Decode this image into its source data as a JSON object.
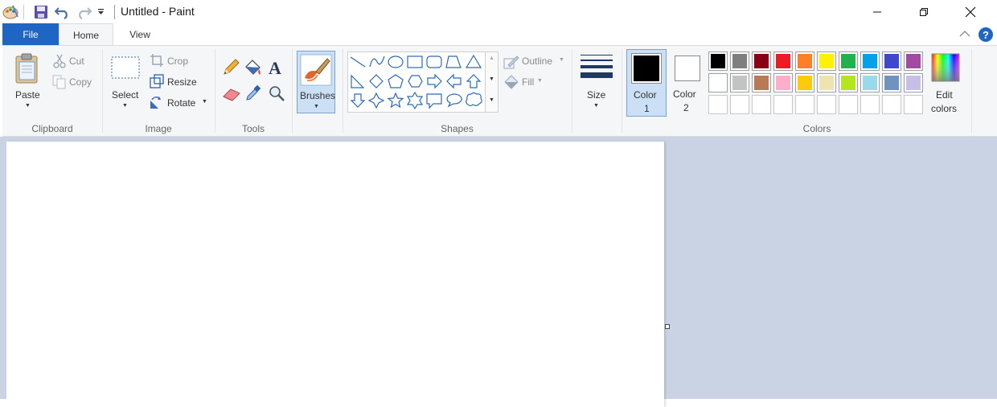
{
  "window": {
    "title": "Untitled - Paint"
  },
  "quick_access": {
    "icons": [
      "paint-app-icon",
      "save-icon",
      "undo-icon",
      "redo-icon",
      "customize-dropdown-icon"
    ]
  },
  "tabs": {
    "file": "File",
    "home": "Home",
    "view": "View"
  },
  "clipboard": {
    "paste": "Paste",
    "cut": "Cut",
    "copy": "Copy",
    "group": "Clipboard"
  },
  "image": {
    "select": "Select",
    "crop": "Crop",
    "resize": "Resize",
    "rotate": "Rotate",
    "group": "Image"
  },
  "tools": {
    "group": "Tools"
  },
  "brushes": {
    "label": "Brushes"
  },
  "shapes": {
    "outline": "Outline",
    "fill": "Fill",
    "group": "Shapes"
  },
  "size": {
    "label": "Size"
  },
  "colors": {
    "color1_line1": "Color",
    "color1_line2": "1",
    "color2_line1": "Color",
    "color2_line2": "2",
    "edit_line1": "Edit",
    "edit_line2": "colors",
    "group": "Colors",
    "color1_value": "#000000",
    "color2_value": "#ffffff",
    "palette_row1": [
      "#000000",
      "#7f7f7f",
      "#880015",
      "#ed1c24",
      "#ff7f27",
      "#fff200",
      "#22b14c",
      "#00a2e8",
      "#3f48cc",
      "#a349a4"
    ],
    "palette_row2": [
      "#ffffff",
      "#c3c3c3",
      "#b97a57",
      "#ffaec9",
      "#ffc90e",
      "#efe4b0",
      "#b5e61d",
      "#99d9ea",
      "#7092be",
      "#c8bfe7"
    ]
  },
  "accent": "#1f66c4"
}
